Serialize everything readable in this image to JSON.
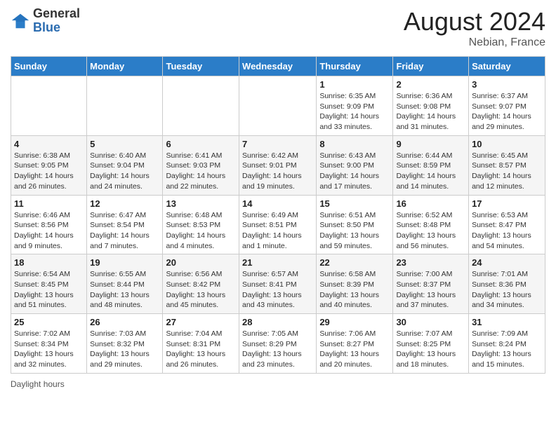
{
  "header": {
    "logo_general": "General",
    "logo_blue": "Blue",
    "month_title": "August 2024",
    "location": "Nebian, France"
  },
  "days_of_week": [
    "Sunday",
    "Monday",
    "Tuesday",
    "Wednesday",
    "Thursday",
    "Friday",
    "Saturday"
  ],
  "weeks": [
    [
      {
        "day": "",
        "info": ""
      },
      {
        "day": "",
        "info": ""
      },
      {
        "day": "",
        "info": ""
      },
      {
        "day": "",
        "info": ""
      },
      {
        "day": "1",
        "info": "Sunrise: 6:35 AM\nSunset: 9:09 PM\nDaylight: 14 hours\nand 33 minutes."
      },
      {
        "day": "2",
        "info": "Sunrise: 6:36 AM\nSunset: 9:08 PM\nDaylight: 14 hours\nand 31 minutes."
      },
      {
        "day": "3",
        "info": "Sunrise: 6:37 AM\nSunset: 9:07 PM\nDaylight: 14 hours\nand 29 minutes."
      }
    ],
    [
      {
        "day": "4",
        "info": "Sunrise: 6:38 AM\nSunset: 9:05 PM\nDaylight: 14 hours\nand 26 minutes."
      },
      {
        "day": "5",
        "info": "Sunrise: 6:40 AM\nSunset: 9:04 PM\nDaylight: 14 hours\nand 24 minutes."
      },
      {
        "day": "6",
        "info": "Sunrise: 6:41 AM\nSunset: 9:03 PM\nDaylight: 14 hours\nand 22 minutes."
      },
      {
        "day": "7",
        "info": "Sunrise: 6:42 AM\nSunset: 9:01 PM\nDaylight: 14 hours\nand 19 minutes."
      },
      {
        "day": "8",
        "info": "Sunrise: 6:43 AM\nSunset: 9:00 PM\nDaylight: 14 hours\nand 17 minutes."
      },
      {
        "day": "9",
        "info": "Sunrise: 6:44 AM\nSunset: 8:59 PM\nDaylight: 14 hours\nand 14 minutes."
      },
      {
        "day": "10",
        "info": "Sunrise: 6:45 AM\nSunset: 8:57 PM\nDaylight: 14 hours\nand 12 minutes."
      }
    ],
    [
      {
        "day": "11",
        "info": "Sunrise: 6:46 AM\nSunset: 8:56 PM\nDaylight: 14 hours\nand 9 minutes."
      },
      {
        "day": "12",
        "info": "Sunrise: 6:47 AM\nSunset: 8:54 PM\nDaylight: 14 hours\nand 7 minutes."
      },
      {
        "day": "13",
        "info": "Sunrise: 6:48 AM\nSunset: 8:53 PM\nDaylight: 14 hours\nand 4 minutes."
      },
      {
        "day": "14",
        "info": "Sunrise: 6:49 AM\nSunset: 8:51 PM\nDaylight: 14 hours\nand 1 minute."
      },
      {
        "day": "15",
        "info": "Sunrise: 6:51 AM\nSunset: 8:50 PM\nDaylight: 13 hours\nand 59 minutes."
      },
      {
        "day": "16",
        "info": "Sunrise: 6:52 AM\nSunset: 8:48 PM\nDaylight: 13 hours\nand 56 minutes."
      },
      {
        "day": "17",
        "info": "Sunrise: 6:53 AM\nSunset: 8:47 PM\nDaylight: 13 hours\nand 54 minutes."
      }
    ],
    [
      {
        "day": "18",
        "info": "Sunrise: 6:54 AM\nSunset: 8:45 PM\nDaylight: 13 hours\nand 51 minutes."
      },
      {
        "day": "19",
        "info": "Sunrise: 6:55 AM\nSunset: 8:44 PM\nDaylight: 13 hours\nand 48 minutes."
      },
      {
        "day": "20",
        "info": "Sunrise: 6:56 AM\nSunset: 8:42 PM\nDaylight: 13 hours\nand 45 minutes."
      },
      {
        "day": "21",
        "info": "Sunrise: 6:57 AM\nSunset: 8:41 PM\nDaylight: 13 hours\nand 43 minutes."
      },
      {
        "day": "22",
        "info": "Sunrise: 6:58 AM\nSunset: 8:39 PM\nDaylight: 13 hours\nand 40 minutes."
      },
      {
        "day": "23",
        "info": "Sunrise: 7:00 AM\nSunset: 8:37 PM\nDaylight: 13 hours\nand 37 minutes."
      },
      {
        "day": "24",
        "info": "Sunrise: 7:01 AM\nSunset: 8:36 PM\nDaylight: 13 hours\nand 34 minutes."
      }
    ],
    [
      {
        "day": "25",
        "info": "Sunrise: 7:02 AM\nSunset: 8:34 PM\nDaylight: 13 hours\nand 32 minutes."
      },
      {
        "day": "26",
        "info": "Sunrise: 7:03 AM\nSunset: 8:32 PM\nDaylight: 13 hours\nand 29 minutes."
      },
      {
        "day": "27",
        "info": "Sunrise: 7:04 AM\nSunset: 8:31 PM\nDaylight: 13 hours\nand 26 minutes."
      },
      {
        "day": "28",
        "info": "Sunrise: 7:05 AM\nSunset: 8:29 PM\nDaylight: 13 hours\nand 23 minutes."
      },
      {
        "day": "29",
        "info": "Sunrise: 7:06 AM\nSunset: 8:27 PM\nDaylight: 13 hours\nand 20 minutes."
      },
      {
        "day": "30",
        "info": "Sunrise: 7:07 AM\nSunset: 8:25 PM\nDaylight: 13 hours\nand 18 minutes."
      },
      {
        "day": "31",
        "info": "Sunrise: 7:09 AM\nSunset: 8:24 PM\nDaylight: 13 hours\nand 15 minutes."
      }
    ]
  ],
  "footer": {
    "daylight_label": "Daylight hours"
  },
  "colors": {
    "header_bg": "#2b7dc8",
    "header_text": "#ffffff",
    "accent": "#2b6cb0"
  }
}
